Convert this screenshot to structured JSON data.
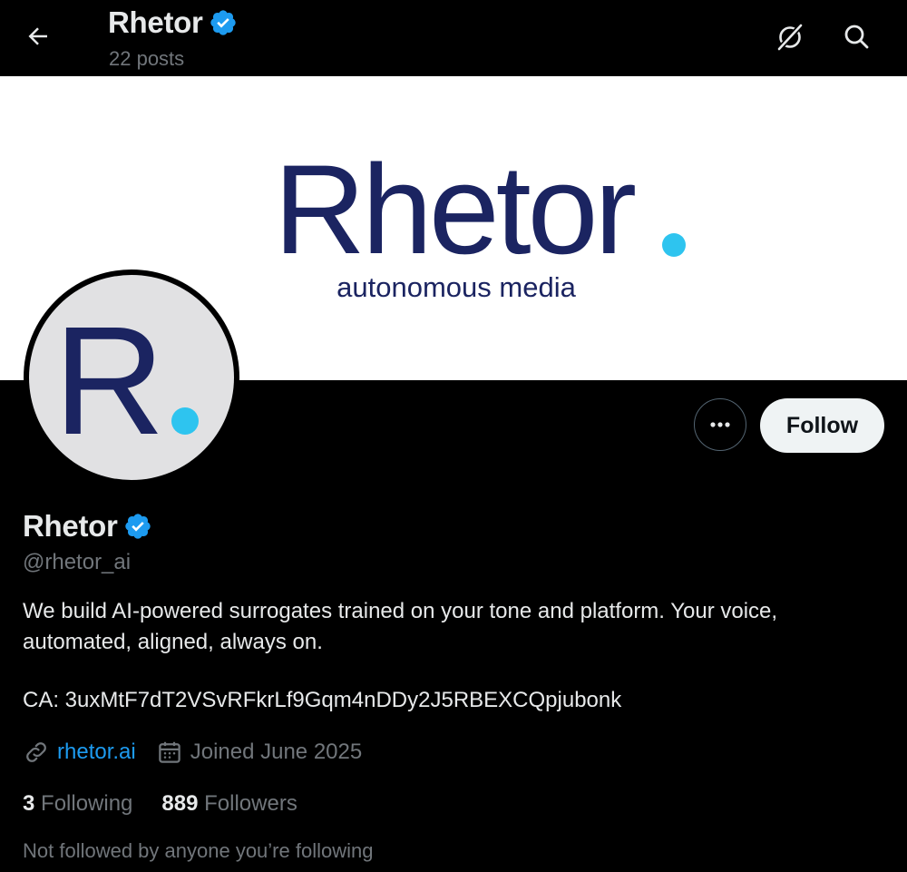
{
  "header": {
    "name": "Rhetor",
    "posts_count": "22 posts"
  },
  "banner": {
    "logo_text": "Rhetor",
    "tagline": "autonomous media",
    "brand_color": "#1b2461",
    "dot_color": "#2ec4ef"
  },
  "avatar": {
    "letter": "R"
  },
  "actions": {
    "follow_label": "Follow",
    "more_icon": "ellipsis-icon"
  },
  "profile": {
    "display_name": "Rhetor",
    "handle": "@rhetor_ai",
    "bio": "We build AI-powered surrogates trained on your tone and platform. Your voice, automated, aligned, always on.",
    "ca_line": "CA: 3uxMtF7dT2VSvRFkrLf9Gqm4nDDy2J5RBEXCQpjubonk",
    "website": "rhetor.ai",
    "joined": "Joined June 2025",
    "following_count": "3",
    "following_label": " Following",
    "followers_count": "889",
    "followers_label": " Followers",
    "mutuals_note": "Not followed by anyone you’re following"
  },
  "colors": {
    "verified": "#1d9bf0",
    "link": "#1d9bf0",
    "muted": "#71767b"
  }
}
